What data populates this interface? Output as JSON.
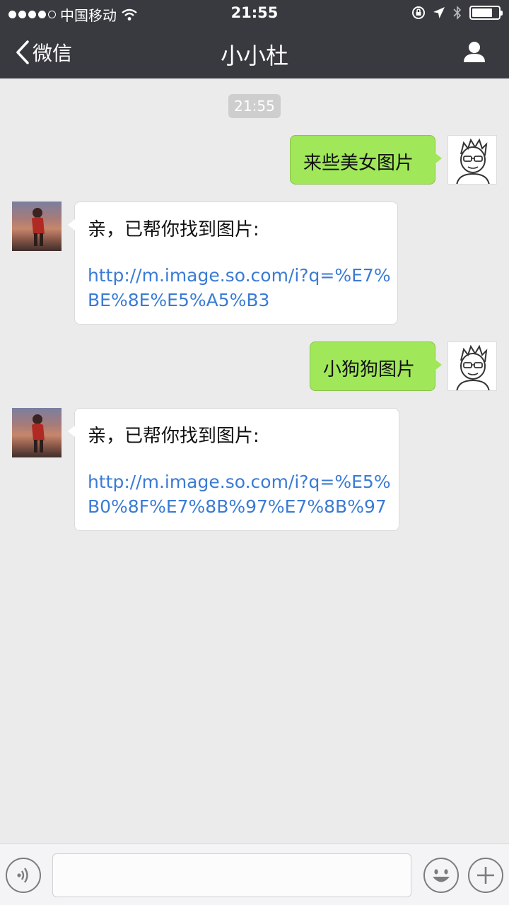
{
  "status_bar": {
    "carrier": "中国移动",
    "time": "21:55",
    "signal_icon": "signal-dots-icon",
    "wifi_icon": "wifi-icon",
    "lock_icon": "orientation-lock-icon",
    "location_icon": "location-arrow-icon",
    "bluetooth_icon": "bluetooth-icon",
    "battery_icon": "battery-icon",
    "battery_level": 0.78
  },
  "navbar": {
    "back_label": "微信",
    "title": "小小杜",
    "contact_icon": "person-icon"
  },
  "chat": {
    "timestamp": "21:55",
    "messages": [
      {
        "from": "me",
        "text": "来些美女图片"
      },
      {
        "from": "bot",
        "intro": "亲，已帮你找到图片:",
        "link": "http://m.image.so.com/i?q=%E7%BE%8E%E5%A5%B3"
      },
      {
        "from": "me",
        "text": "小狗狗图片"
      },
      {
        "from": "bot",
        "intro": "亲，已帮你找到图片:",
        "link": "http://m.image.so.com/i?q=%E5%B0%8F%E7%8B%97%E7%8B%97"
      }
    ]
  },
  "input_bar": {
    "voice_icon": "voice-input-icon",
    "emoji_icon": "emoji-icon",
    "plus_icon": "plus-icon",
    "text_value": ""
  },
  "colors": {
    "bar_bg": "#393a3f",
    "chat_bg": "#ebebeb",
    "sent_bubble": "#a0e75a",
    "received_bubble": "#ffffff",
    "link": "#3a7bd5"
  }
}
